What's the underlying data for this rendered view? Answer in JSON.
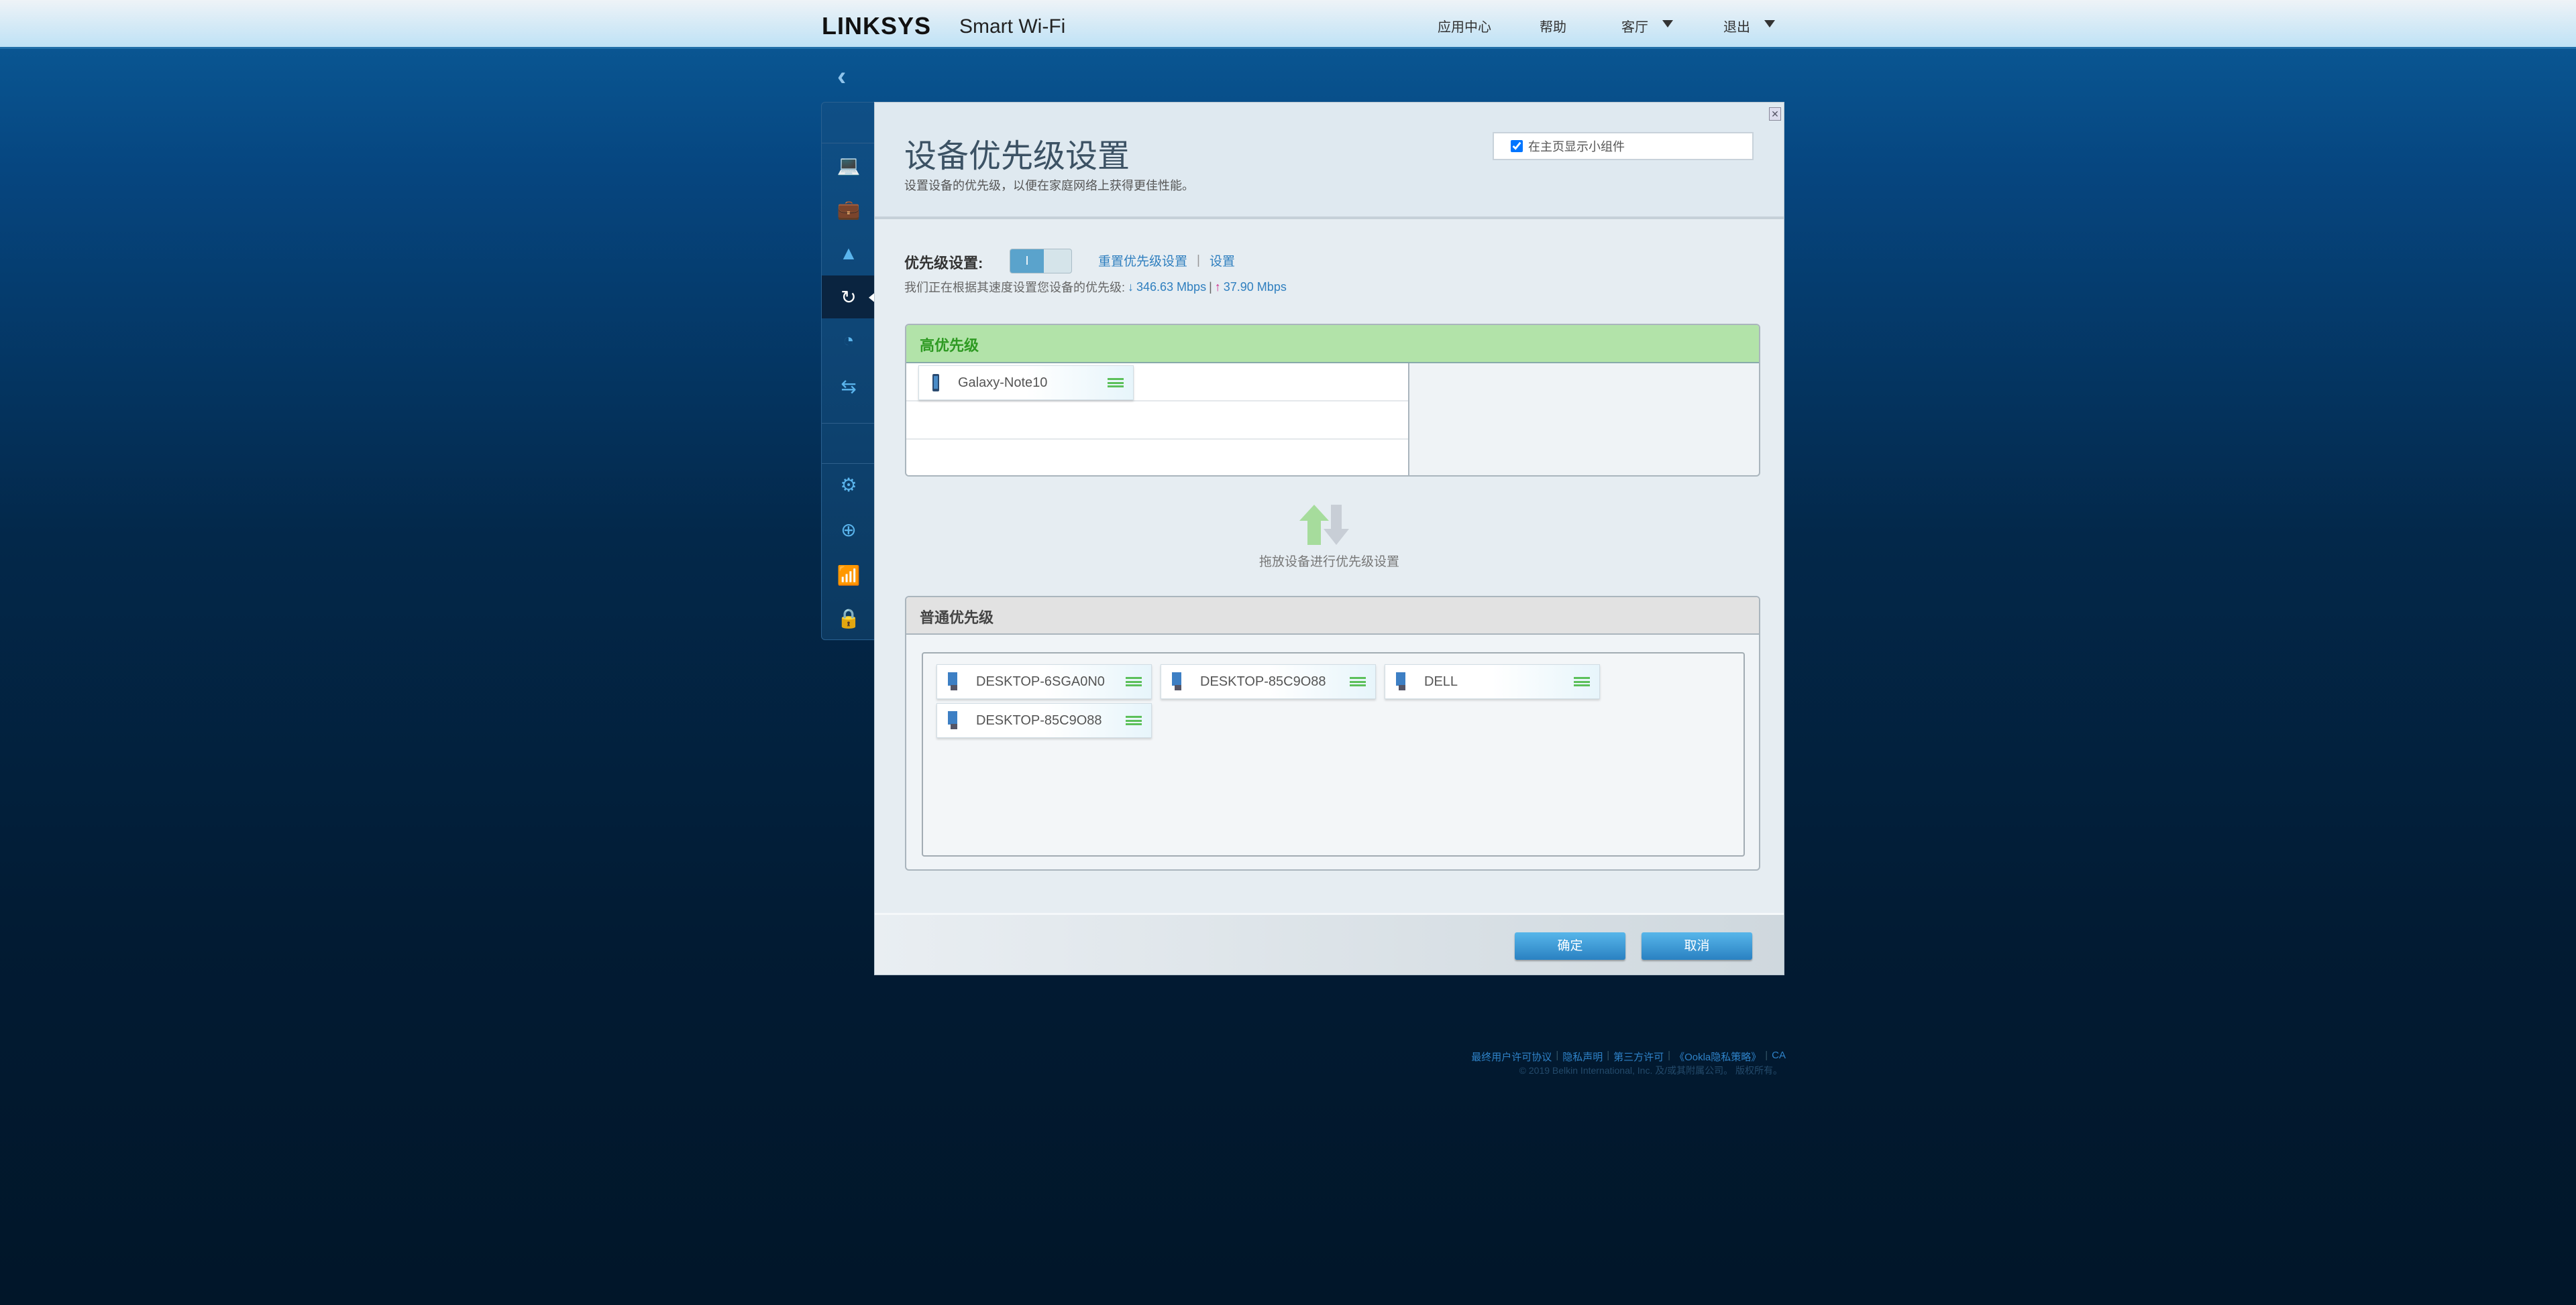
{
  "header": {
    "brand": "LINKSYS",
    "brand_sub": "Smart Wi-Fi",
    "nav": [
      "应用中心",
      "帮助",
      "客厅",
      "退出"
    ]
  },
  "sidebar": {
    "icons": [
      "devices-icon",
      "guest-access-icon",
      "parental-controls-icon",
      "media-prioritization-icon",
      "speed-test-icon",
      "external-storage-icon",
      "connectivity-icon",
      "troubleshooting-icon",
      "wireless-icon",
      "security-icon"
    ],
    "active": "media-prioritization-icon"
  },
  "dialog": {
    "title": "设备优先级设置",
    "subtitle": "设置设备的优先级，以便在家庭网络上获得更佳性能。",
    "widget_checkbox": {
      "label": "在主页显示小组件",
      "checked": true
    },
    "priority_label": "优先级设置:",
    "toggle": {
      "state": "on",
      "label": "I"
    },
    "reset_link": "重置优先级设置",
    "link_sep": "|",
    "settings_link": "设置",
    "speed": {
      "text": "我们正在根据其速度设置您设备的优先级:",
      "down": "346.63 Mbps",
      "sep": "|",
      "up": "37.90 Mbps"
    },
    "high": {
      "title": "高优先级",
      "devices": [
        {
          "name": "Galaxy-Note10",
          "type": "phone"
        }
      ]
    },
    "drag_hint": "拖放设备进行优先级设置",
    "normal": {
      "title": "普通优先级",
      "devices": [
        {
          "name": "DESKTOP-6SGA0N0",
          "type": "computer"
        },
        {
          "name": "DESKTOP-85C9O88",
          "type": "computer"
        },
        {
          "name": "DELL",
          "type": "computer"
        },
        {
          "name": "DESKTOP-85C9O88",
          "type": "computer"
        }
      ]
    },
    "ok": "确定",
    "cancel": "取消"
  },
  "footer": {
    "links": [
      "最终用户许可协议",
      "隐私声明",
      "第三方许可",
      "《Ookla隐私策略》",
      "CA"
    ],
    "copyright": "© 2019 Belkin International, Inc. 及/或其附属公司。 版权所有。"
  },
  "colors": {
    "accent": "#2f7fbf",
    "high_header": "#b2e3a9",
    "handle": "#5cc05a"
  }
}
